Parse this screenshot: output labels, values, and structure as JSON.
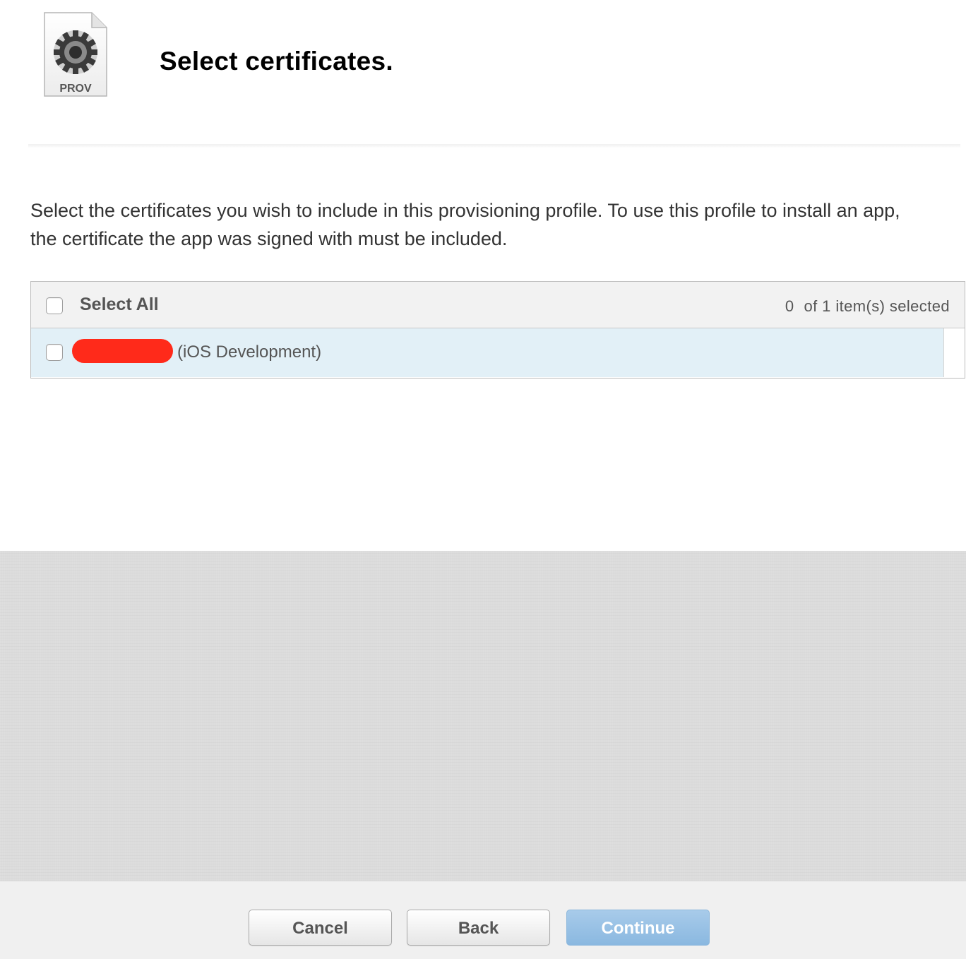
{
  "header": {
    "icon_label": "PROV",
    "title": "Select certificates."
  },
  "description": "Select the certificates you wish to include in this provisioning profile. To use this profile to install an app, the certificate the app was signed with must be included.",
  "table": {
    "select_all_label": "Select All",
    "selected_number": "0",
    "selected_suffix": "of 1 item(s) selected",
    "rows": [
      {
        "name_redacted": true,
        "type": "(iOS Development)",
        "checked": false
      }
    ]
  },
  "footer": {
    "cancel_label": "Cancel",
    "back_label": "Back",
    "continue_label": "Continue"
  },
  "colors": {
    "row_highlight": "#e2f0f7",
    "redaction": "#ff2a1a",
    "continue_button": "#9cc3e6"
  }
}
